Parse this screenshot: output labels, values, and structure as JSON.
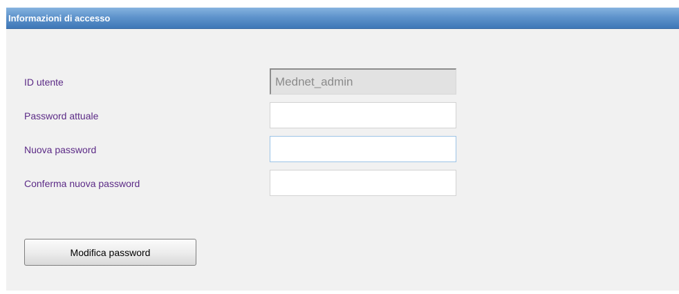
{
  "panel": {
    "title": "Informazioni di accesso"
  },
  "form": {
    "user_id": {
      "label": "ID utente",
      "value": "Mednet_admin"
    },
    "current_password": {
      "label": "Password attuale",
      "value": ""
    },
    "new_password": {
      "label": "Nuova password",
      "value": ""
    },
    "confirm_password": {
      "label": "Conferma nuova password",
      "value": ""
    }
  },
  "actions": {
    "change_password_label": "Modifica password"
  }
}
